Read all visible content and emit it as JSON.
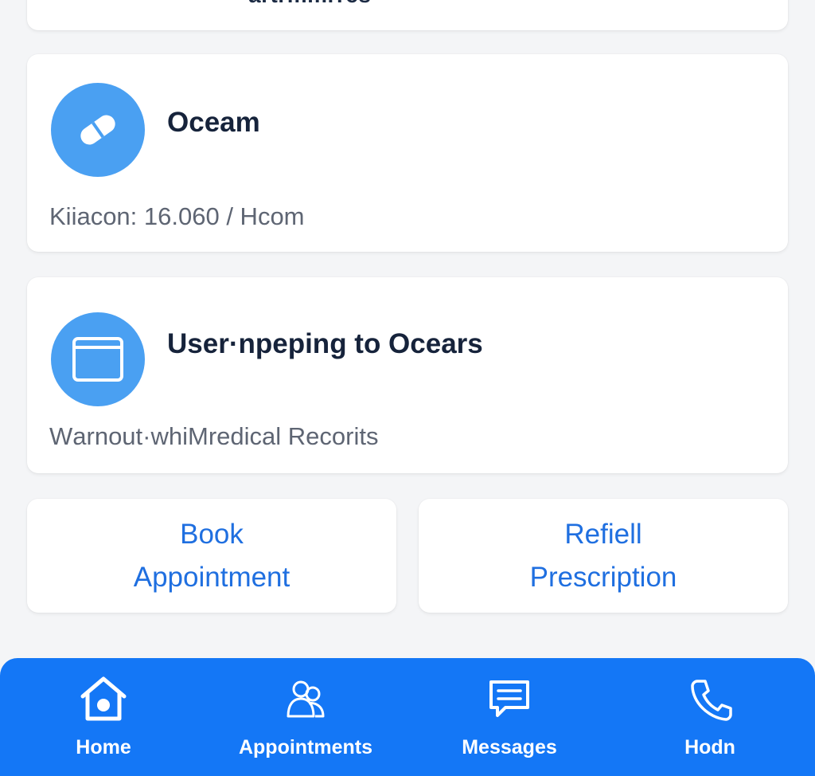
{
  "top_card": {
    "partial_text": "artrmmrrcs"
  },
  "cards": [
    {
      "icon": "pill-icon",
      "title": "Oceam",
      "subtitle": "Kiiacon: 16.060 / Hcom"
    },
    {
      "icon": "window-icon",
      "title": "User·npeping to Ocears",
      "subtitle": "Wаrnout·whiMredical Recorits"
    }
  ],
  "actions": {
    "book": {
      "line1": "Book",
      "line2": "Appointment"
    },
    "refill": {
      "line1": "Refiell",
      "line2": "Prescription"
    }
  },
  "bottom_nav": {
    "items": [
      {
        "label": "Home",
        "icon": "home-icon"
      },
      {
        "label": "Appointments",
        "icon": "people-icon"
      },
      {
        "label": "Messages",
        "icon": "message-icon"
      },
      {
        "label": "Hodn",
        "icon": "phone-icon"
      }
    ]
  },
  "colors": {
    "accent": "#1477f6",
    "icon_circle": "#4aa0f2",
    "action_text": "#1f6fe0",
    "background": "#f4f5f7"
  }
}
